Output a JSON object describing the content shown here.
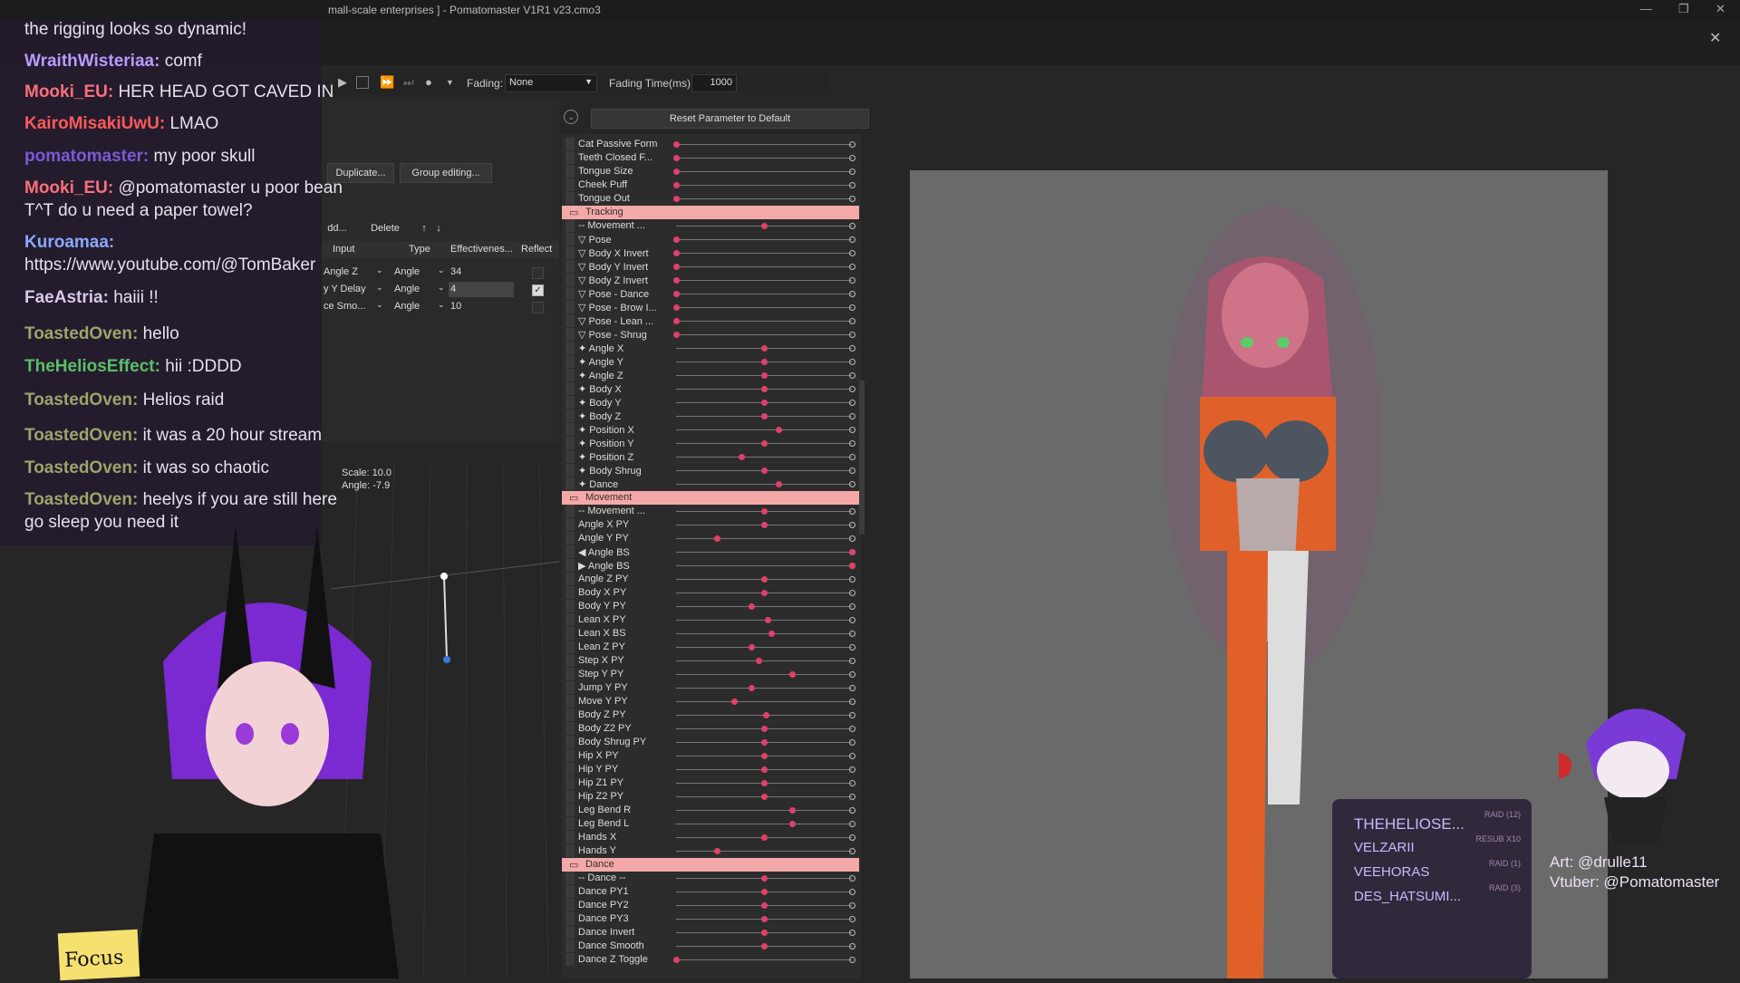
{
  "window": {
    "title": "mall-scale enterprises ] - Pomatomaster V1R1 v23.cmo3",
    "controls": [
      "—",
      "❐",
      "✕"
    ]
  },
  "toolbar": {
    "fading_label": "Fading:",
    "fading_value": "None",
    "fading_time_label": "Fading Time(ms):",
    "fading_time_value": "1000"
  },
  "param_panel": {
    "reset_button": "Reset Parameter to Default"
  },
  "left_panel": {
    "duplicate": "Duplicate...",
    "group_editing": "Group editing...",
    "add": "dd...",
    "delete": "Delete",
    "up": "↑",
    "down": "↓",
    "headers": [
      "Input",
      "Type",
      "Effectivenes...",
      "Reflect"
    ],
    "rows": [
      {
        "input": "Angle Z",
        "type": "Angle",
        "eff": "34",
        "reflect": false
      },
      {
        "input": "y Y Delay",
        "type": "Angle",
        "eff": "4",
        "reflect": true
      },
      {
        "input": "ce Smo...",
        "type": "Angle",
        "eff": "10",
        "reflect": false
      }
    ]
  },
  "graph": {
    "scale": "Scale: 10.0",
    "angle": "Angle: -7.9"
  },
  "params": [
    {
      "label": "Cat Passive Form",
      "dot": 0.0
    },
    {
      "label": "Teeth Closed F...",
      "dot": 0.0
    },
    {
      "label": "Tongue Size",
      "dot": 0.0
    },
    {
      "label": "Cheek Puff",
      "dot": 0.0
    },
    {
      "label": "Tongue Out",
      "dot": 0.0
    },
    {
      "group": "Tracking"
    },
    {
      "label": "-- Movement ...",
      "dot": 0.5
    },
    {
      "label": "▽ Pose",
      "dot": 0.0
    },
    {
      "label": "▽ Body X Invert",
      "dot": 0.0
    },
    {
      "label": "▽ Body Y Invert",
      "dot": 0.0
    },
    {
      "label": "▽ Body Z Invert",
      "dot": 0.0
    },
    {
      "label": "▽ Pose - Dance",
      "dot": 0.0
    },
    {
      "label": "▽ Pose - Brow I...",
      "dot": 0.0
    },
    {
      "label": "▽ Pose - Lean ...",
      "dot": 0.0
    },
    {
      "label": "▽ Pose - Shrug",
      "dot": 0.0
    },
    {
      "label": "✦ Angle X",
      "dot": 0.5
    },
    {
      "label": "✦ Angle Y",
      "dot": 0.5
    },
    {
      "label": "✦ Angle Z",
      "dot": 0.5
    },
    {
      "label": "✦ Body X",
      "dot": 0.5
    },
    {
      "label": "✦ Body Y",
      "dot": 0.5
    },
    {
      "label": "✦ Body Z",
      "dot": 0.5
    },
    {
      "label": "✦ Position X",
      "dot": 0.58
    },
    {
      "label": "✦ Position Y",
      "dot": 0.5
    },
    {
      "label": "✦ Position Z",
      "dot": 0.37
    },
    {
      "label": "✦ Body Shrug",
      "dot": 0.5
    },
    {
      "label": "✦ Dance",
      "dot": 0.58
    },
    {
      "group": "Movement"
    },
    {
      "label": "-- Movement ...",
      "dot": 0.5
    },
    {
      "label": "Angle X PY",
      "dot": 0.5
    },
    {
      "label": "Angle Y PY",
      "dot": 0.23
    },
    {
      "label": "◀ Angle BS",
      "dot": 1.0
    },
    {
      "label": "▶ Angle BS",
      "dot": 1.0
    },
    {
      "label": "Angle Z PY",
      "dot": 0.5
    },
    {
      "label": "Body X PY",
      "dot": 0.5
    },
    {
      "label": "Body Y PY",
      "dot": 0.43
    },
    {
      "label": "Lean X PY",
      "dot": 0.52
    },
    {
      "label": "Lean X BS",
      "dot": 0.54
    },
    {
      "label": "Lean Z PY",
      "dot": 0.43
    },
    {
      "label": "Step X PY",
      "dot": 0.47
    },
    {
      "label": "Step Y PY",
      "dot": 0.66
    },
    {
      "label": "Jump Y PY",
      "dot": 0.43
    },
    {
      "label": "Move Y PY",
      "dot": 0.33
    },
    {
      "label": "Body Z PY",
      "dot": 0.51
    },
    {
      "label": "Body Z2 PY",
      "dot": 0.5
    },
    {
      "label": "Body Shrug PY",
      "dot": 0.5
    },
    {
      "label": "Hip X PY",
      "dot": 0.5
    },
    {
      "label": "Hip Y PY",
      "dot": 0.5
    },
    {
      "label": "Hip Z1 PY",
      "dot": 0.5
    },
    {
      "label": "Hip Z2 PY",
      "dot": 0.5
    },
    {
      "label": "Leg Bend R",
      "dot": 0.66
    },
    {
      "label": "Leg Bend L",
      "dot": 0.66
    },
    {
      "label": "Hands X",
      "dot": 0.5
    },
    {
      "label": "Hands Y",
      "dot": 0.23
    },
    {
      "group": "Dance"
    },
    {
      "label": "-- Dance --",
      "dot": 0.5
    },
    {
      "label": "Dance PY1",
      "dot": 0.5
    },
    {
      "label": "Dance PY2",
      "dot": 0.5
    },
    {
      "label": "Dance PY3",
      "dot": 0.5
    },
    {
      "label": "Dance Invert",
      "dot": 0.5
    },
    {
      "label": "Dance Smooth",
      "dot": 0.5
    },
    {
      "label": "Dance Z Toggle",
      "dot": 0.0
    }
  ],
  "chat": [
    {
      "user": "",
      "text": "the rigging looks so dynamic!",
      "color": "#e4e2ea"
    },
    {
      "user": "WraithWisteriaa:",
      "text": "comf",
      "color": "#b89cff"
    },
    {
      "user": "Mooki_EU:",
      "text": "HER HEAD GOT CAVED IN",
      "color": "#ff6f7a"
    },
    {
      "user": "KairoMisakiUwU:",
      "text": "LMAO",
      "color": "#ff5a5a"
    },
    {
      "user": "pomatomaster:",
      "text": "my poor skull",
      "color": "#7a5bd6"
    },
    {
      "user": "Mooki_EU:",
      "text": "@pomatomaster u poor bean",
      "color": "#ff6f7a"
    },
    {
      "user": "",
      "text": "T^T do u need a paper towel?",
      "color": "#e4e2ea"
    },
    {
      "user": "Kuroamaa:",
      "text": "",
      "color": "#8aa8ff"
    },
    {
      "user": "",
      "text": "https://www.youtube.com/@TomBaker",
      "color": "#e4e2ea"
    },
    {
      "user": "FaeAstria:",
      "text": "haiii !!",
      "color": "#d6c8e8"
    },
    {
      "user": "ToastedOven:",
      "text": "hello",
      "color": "#9aa56a"
    },
    {
      "user": "TheHeliosEffect:",
      "text": "hii :DDDD",
      "color": "#5bbf6a"
    },
    {
      "user": "ToastedOven:",
      "text": "Helios raid",
      "color": "#9aa56a"
    },
    {
      "user": "ToastedOven:",
      "text": "it was a 20 hour stream",
      "color": "#9aa56a"
    },
    {
      "user": "ToastedOven:",
      "text": "it was so chaotic",
      "color": "#9aa56a"
    },
    {
      "user": "ToastedOven:",
      "text": "heelys if you are still here",
      "color": "#9aa56a"
    },
    {
      "user": "",
      "text": "go sleep you need it",
      "color": "#e4e2ea"
    }
  ],
  "events": [
    {
      "name": "THEHELIOSE...",
      "tag": "RAID (12)"
    },
    {
      "name": "VELZARII",
      "tag": "RESUB X10"
    },
    {
      "name": "VEEHORAS",
      "tag": "RAID (1)"
    },
    {
      "name": "DES_HATSUMI...",
      "tag": "RAID (3)"
    }
  ],
  "sticky_note": "Focus",
  "credits": {
    "art": "Art: @drulle11",
    "vtuber": "Vtuber: @Pomatomaster"
  }
}
